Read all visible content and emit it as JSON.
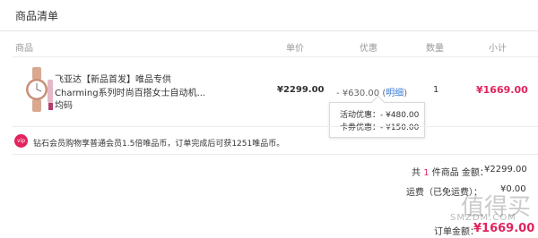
{
  "header": {
    "title": "商品清单"
  },
  "columns": {
    "product": "商品",
    "unit_price": "单价",
    "discount": "优惠",
    "quantity": "数量",
    "subtotal": "小计"
  },
  "item": {
    "title_line1": "飞亚达【新品首发】唯品专供",
    "title_line2": "Charming系列时尚百搭女士自动机...",
    "size": "均码",
    "price": "¥2299.00",
    "discount_amount": "- ¥630.00 (",
    "detail_link": "明细",
    "discount_close": ")",
    "quantity": "1",
    "subtotal": "¥1669.00"
  },
  "discount_popup": {
    "activity": "活动优惠：- ¥480.00",
    "coupon": "卡券优惠：- ¥150.00"
  },
  "notice": {
    "icon_text": "vip",
    "text": "钻石会员购物享普通会员1.5倍唯品币，订单完成后可获1251唯品币。"
  },
  "summary": {
    "count_prefix": "共 ",
    "count": "1",
    "count_suffix": " 件商品 金额：",
    "amount": "¥2299.00",
    "shipping_label": "运费（已免运费）：",
    "shipping_value": "¥0.00",
    "final_label": "订单金额：",
    "final_value": "¥1669.00"
  },
  "watermark": {
    "main": "值得买",
    "sub": "SMZDM.COM"
  },
  "colors": {
    "accent": "#e0245e",
    "link": "#3b7bd5"
  }
}
